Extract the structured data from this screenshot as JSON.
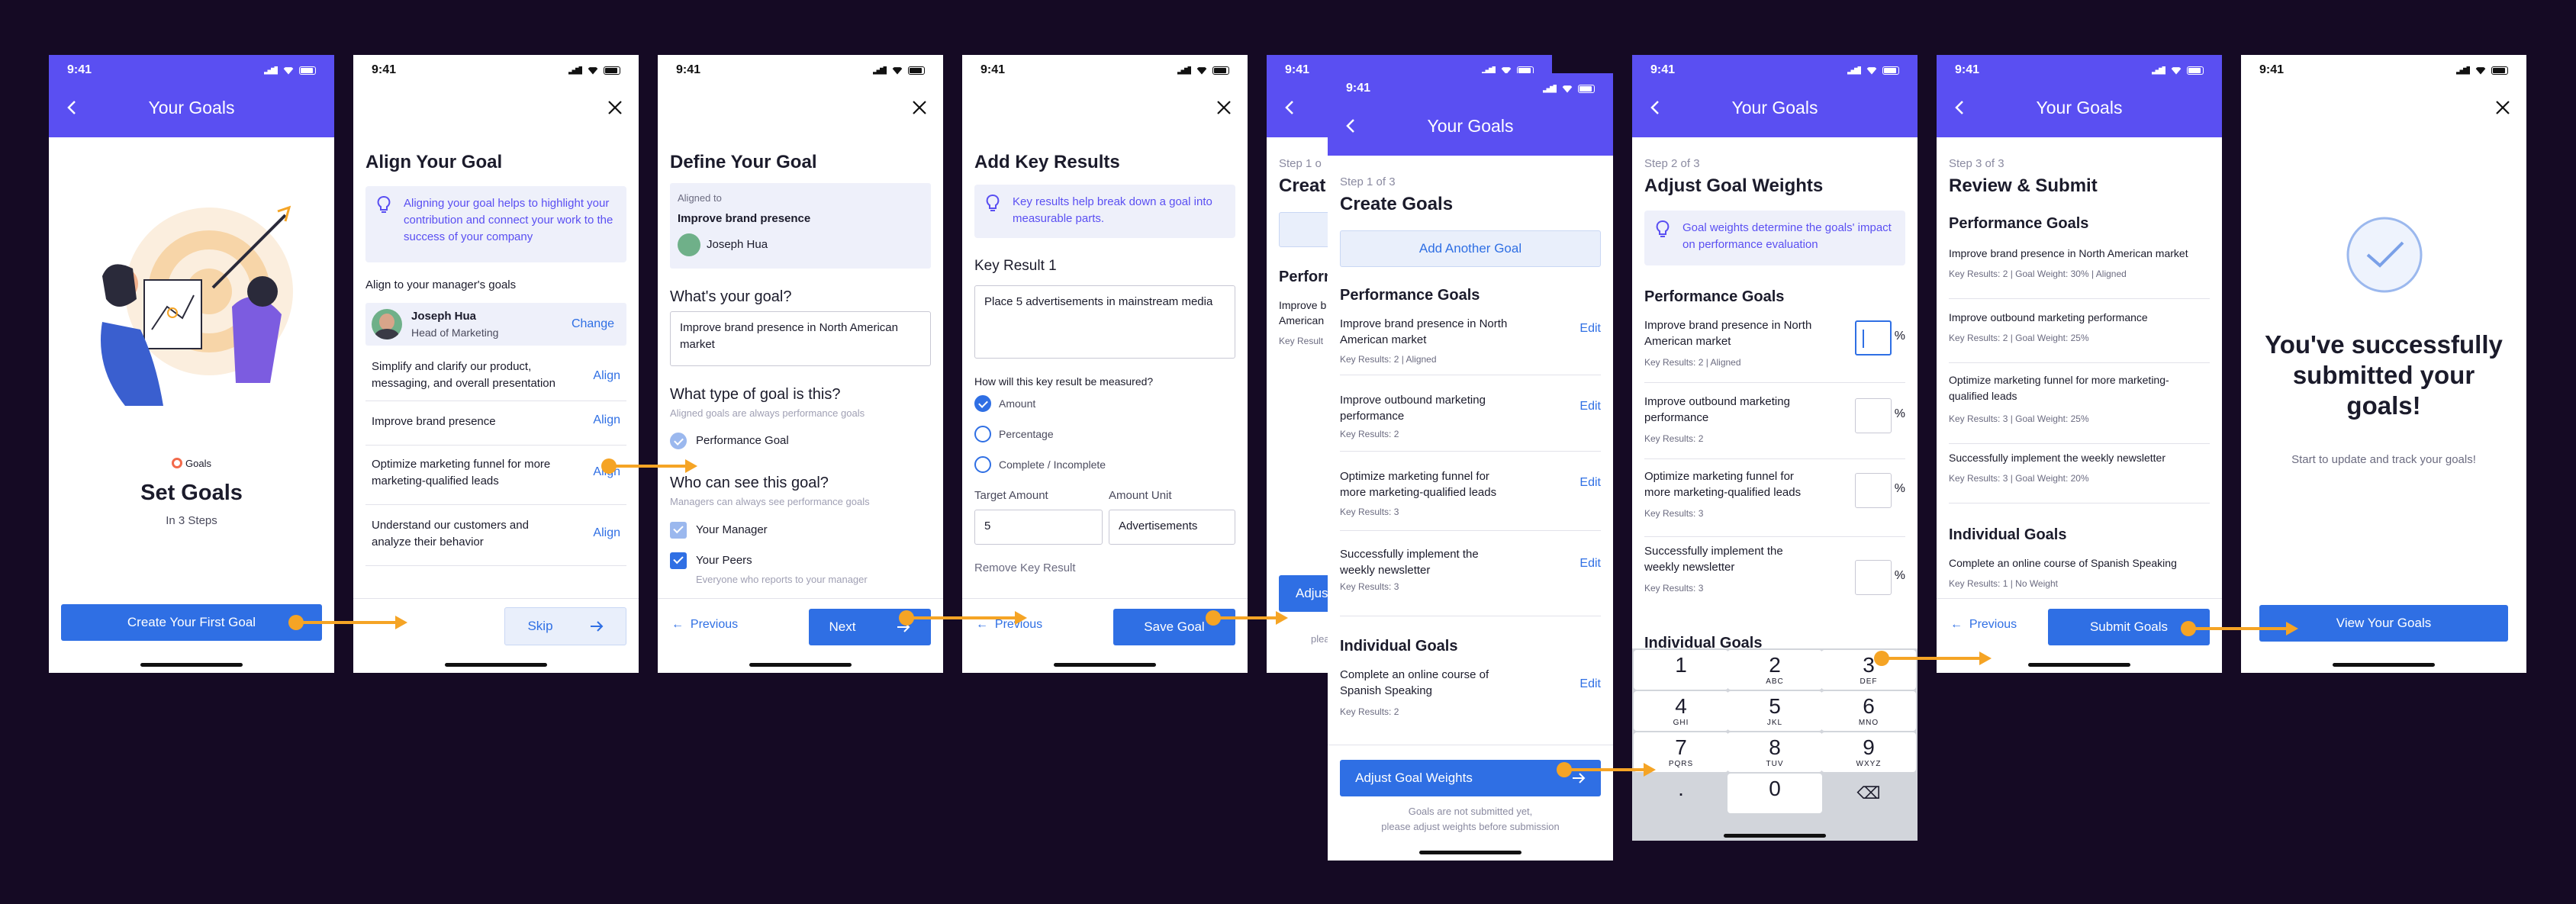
{
  "status_time": "9:41",
  "header_title": "Your Goals",
  "s1": {
    "brand": "Goals",
    "title": "Set Goals",
    "subtitle": "In 3 Steps",
    "cta": "Create Your First Goal"
  },
  "s2": {
    "title": "Align Your Goal",
    "info": "Aligning your goal helps to highlight your contribution and connect your work to the success of your company",
    "align_label": "Align to your manager's goals",
    "manager_name": "Joseph Hua",
    "manager_role": "Head of Marketing",
    "change": "Change",
    "goals": [
      {
        "text": "Simplify and clarify our product, messaging, and overall presentation",
        "action": "Align"
      },
      {
        "text": "Improve brand presence",
        "action": "Align"
      },
      {
        "text": "Optimize marketing funnel for more marketing-qualified leads",
        "action": "Align"
      },
      {
        "text": "Understand our customers and analyze their behavior",
        "action": "Align"
      }
    ],
    "skip": "Skip"
  },
  "s3": {
    "title": "Define Your Goal",
    "aligned_to": "Aligned to",
    "aligned_goal": "Improve brand presence",
    "aligned_person": "Joseph Hua",
    "q1": "What's your goal?",
    "goal_value": "Improve brand presence in North American market",
    "q2": "What type of goal is this?",
    "q2_hint": "Aligned goals are always performance goals",
    "type_option": "Performance Goal",
    "q3": "Who can see this goal?",
    "q3_hint": "Managers can always see performance goals",
    "vis1": "Your Manager",
    "vis2": "Your Peers",
    "vis2_hint": "Everyone who reports to your manager",
    "prev": "Previous",
    "next": "Next"
  },
  "s4": {
    "title": "Add Key Results",
    "info": "Key results help break down a goal into measurable parts.",
    "kr_label": "Key Result 1",
    "kr_value": "Place 5 advertisements in mainstream media",
    "measure_q": "How will this key result be measured?",
    "opt1": "Amount",
    "opt2": "Percentage",
    "opt3": "Complete / Incomplete",
    "target_label": "Target Amount",
    "unit_label": "Amount Unit",
    "target_value": "5",
    "unit_value": "Advertisements",
    "remove": "Remove Key Result",
    "prev": "Previous",
    "save": "Save Goal"
  },
  "s5bg": {
    "step": "Step 1 o",
    "title": "Creat",
    "perf": "Perform",
    "g1a": "Improve b",
    "g1b": "American",
    "g1c": "Key Result",
    "btn": "Adjus",
    "note": "plea"
  },
  "s5": {
    "step": "Step 1 of 3",
    "title": "Create Goals",
    "add": "Add Another Goal",
    "perf": "Performance Goals",
    "goals": [
      {
        "text": "Improve brand presence in North American market",
        "meta": "Key Results: 2  |  Aligned",
        "edit": "Edit"
      },
      {
        "text": "Improve outbound marketing performance",
        "meta": "Key Results: 2",
        "edit": "Edit"
      },
      {
        "text": "Optimize marketing funnel for more marketing-qualified leads",
        "meta": "Key Results: 3",
        "edit": "Edit"
      },
      {
        "text": "Successfully implement the weekly newsletter",
        "meta": "Key Results: 3",
        "edit": "Edit"
      }
    ],
    "indiv": "Individual Goals",
    "igoal": {
      "text": "Complete an online course of Spanish Speaking",
      "meta": "Key Results: 2",
      "edit": "Edit"
    },
    "cta": "Adjust Goal Weights",
    "note1": "Goals are not submitted yet,",
    "note2": "please adjust weights before submission"
  },
  "s6": {
    "step": "Step 2 of 3",
    "title": "Adjust Goal Weights",
    "info": "Goal weights determine the goals' impact on performance evaluation",
    "perf": "Performance Goals",
    "goals": [
      {
        "text": "Improve brand presence in North American market",
        "meta": "Key Results: 2  |  Aligned"
      },
      {
        "text": "Improve outbound marketing performance",
        "meta": "Key Results: 2"
      },
      {
        "text": "Optimize marketing funnel for more marketing-qualified leads",
        "meta": "Key Results: 3"
      },
      {
        "text": "Successfully implement the weekly newsletter",
        "meta": "Key Results: 3"
      }
    ],
    "pct": "%",
    "indiv": "Individual Goals",
    "keys": [
      {
        "n": "1",
        "l": ""
      },
      {
        "n": "2",
        "l": "ABC"
      },
      {
        "n": "3",
        "l": "DEF"
      },
      {
        "n": "4",
        "l": "GHI"
      },
      {
        "n": "5",
        "l": "JKL"
      },
      {
        "n": "6",
        "l": "MNO"
      },
      {
        "n": "7",
        "l": "PQRS"
      },
      {
        "n": "8",
        "l": "TUV"
      },
      {
        "n": "9",
        "l": "WXYZ"
      },
      {
        "n": ".",
        "l": ""
      },
      {
        "n": "0",
        "l": ""
      },
      {
        "n": "⌫",
        "l": ""
      }
    ]
  },
  "s7": {
    "step": "Step 3 of 3",
    "title": "Review & Submit",
    "perf": "Performance Goals",
    "goals": [
      {
        "text": "Improve brand presence in North American market",
        "meta": "Key Results: 2  |  Goal Weight: 30%  |  Aligned"
      },
      {
        "text": "Improve outbound marketing performance",
        "meta": "Key Results: 2  |  Goal Weight: 25%"
      },
      {
        "text": "Optimize marketing funnel for more marketing-qualified leads",
        "meta": "Key Results: 3  |  Goal Weight: 25%"
      },
      {
        "text": "Successfully implement the weekly newsletter",
        "meta": "Key Results: 3  |  Goal Weight: 20%"
      }
    ],
    "indiv": "Individual Goals",
    "igoal": {
      "text": "Complete an online course of Spanish Speaking",
      "meta": "Key Results: 1  |  No Weight"
    },
    "prev": "Previous",
    "submit": "Submit Goals"
  },
  "s8": {
    "title": "You've successfully submitted your goals!",
    "sub": "Start to update and track your goals!",
    "cta": "View Your Goals"
  }
}
